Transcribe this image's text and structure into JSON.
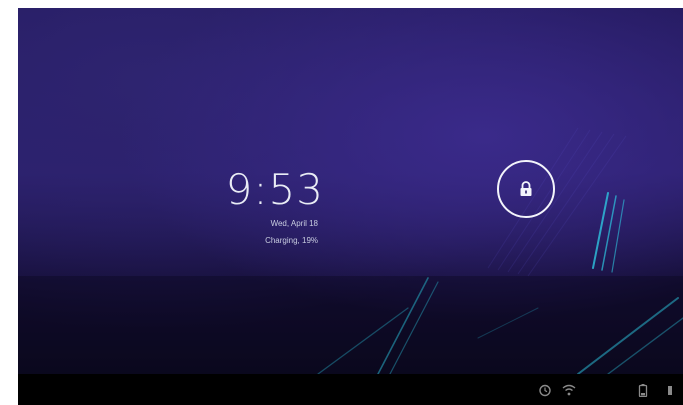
{
  "lockscreen": {
    "time": "9:53",
    "date": "Wed, April 18",
    "charging": "Charging, 19%"
  },
  "icons": {
    "lock": "lock-icon",
    "status": [
      "alarm-icon",
      "wifi-icon",
      "battery-icon",
      "signal-icon"
    ]
  },
  "colors": {
    "background": "#241a5e",
    "accent_lines": "#2ec4e0",
    "text": "#e9ecf5",
    "navbar": "#000000"
  }
}
